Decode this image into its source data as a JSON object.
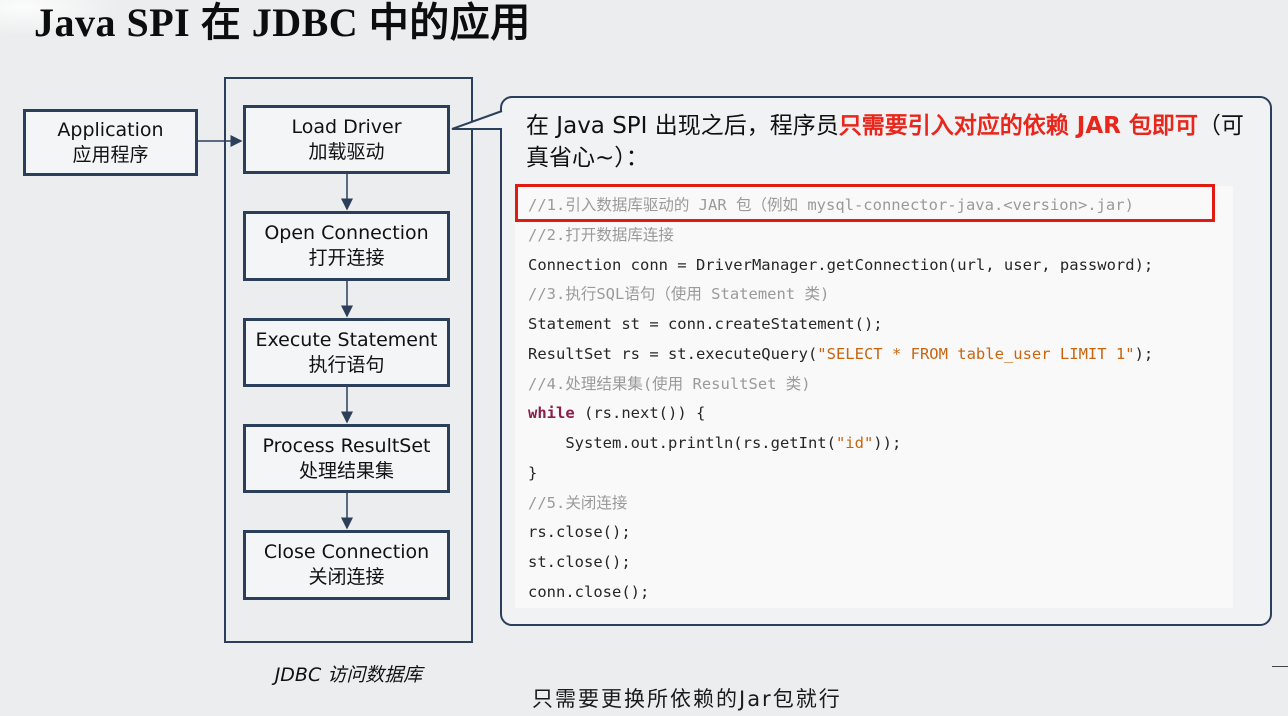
{
  "title": "Java SPI 在 JDBC 中的应用",
  "flow": {
    "application": {
      "en": "Application",
      "zh": "应用程序"
    },
    "steps": [
      {
        "en": "Load Driver",
        "zh": "加载驱动"
      },
      {
        "en": "Open Connection",
        "zh": "打开连接"
      },
      {
        "en": "Execute Statement",
        "zh": "执行语句"
      },
      {
        "en": "Process ResultSet",
        "zh": "处理结果集"
      },
      {
        "en": "Close Connection",
        "zh": "关闭连接"
      }
    ],
    "frame_label": "JDBC 访问数据库"
  },
  "callout": {
    "intro_prefix": "在 Java SPI 出现之后，程序员",
    "intro_highlight": "只需要引入对应的依赖 JAR 包即可",
    "intro_suffix": "（可真省心~）：",
    "highlight_color": "#e8261c"
  },
  "code": {
    "lines": [
      "//1.引入数据库驱动的 JAR 包（例如 mysql-connector-java.<version>.jar)",
      "//2.打开数据库连接",
      "Connection conn = DriverManager.getConnection(url, user, password);",
      "//3.执行SQL语句（使用 Statement 类)",
      "Statement st = conn.createStatement();",
      "ResultSet rs = st.executeQuery(",
      "\"SELECT * FROM table_user LIMIT 1\"",
      ");",
      "//4.处理结果集(使用 ResultSet 类)",
      "while",
      " (rs.next()) {",
      "    System.out.println(rs.getInt(",
      "\"id\"",
      "));",
      "}",
      "//5.关闭连接",
      "rs.close();",
      "st.close();",
      "conn.close();"
    ]
  },
  "subtitle": "只需要更换所依赖的Jar包就行",
  "colors": {
    "border": "#2b3f5b",
    "red_box": "#e01b12",
    "string": "#c8650e",
    "keyword": "#8a1f4a",
    "comment": "#9a9a9a"
  }
}
